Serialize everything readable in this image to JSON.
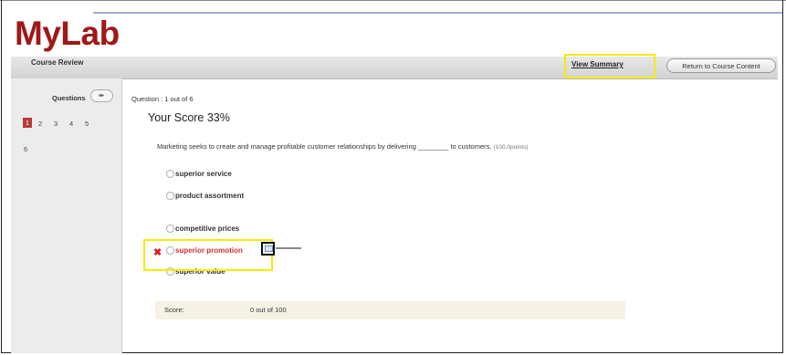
{
  "app": {
    "logo_text": "MyLab"
  },
  "header": {
    "title": "Course Review",
    "view_summary_label": "View Summary",
    "return_label": "Return to Course Content"
  },
  "sidebar": {
    "questions_label": "Questions",
    "toggle_icon": "arrow-right-icon",
    "question_numbers": [
      "1",
      "2",
      "3",
      "4",
      "5",
      "6"
    ],
    "active_question": "1"
  },
  "main": {
    "question_counter": "Question : 1 out of 6",
    "score_title": "Your Score 33%",
    "question_text": "Marketing seeks to create and manage profitable customer relationships by delivering ________ to customers.",
    "points_text": "(100.0points)",
    "options": [
      {
        "label": "superior service"
      },
      {
        "label": "product assortment"
      },
      {
        "label": "competitive prices"
      },
      {
        "label": "superior promotion"
      },
      {
        "label": "superior value"
      }
    ],
    "score_label": "Score:",
    "score_value": "0 out of 100"
  },
  "colors": {
    "brand": "#a01818",
    "highlight": "#f5ec00",
    "wrong": "#d23030",
    "active_question_bg": "#b83a3a"
  }
}
